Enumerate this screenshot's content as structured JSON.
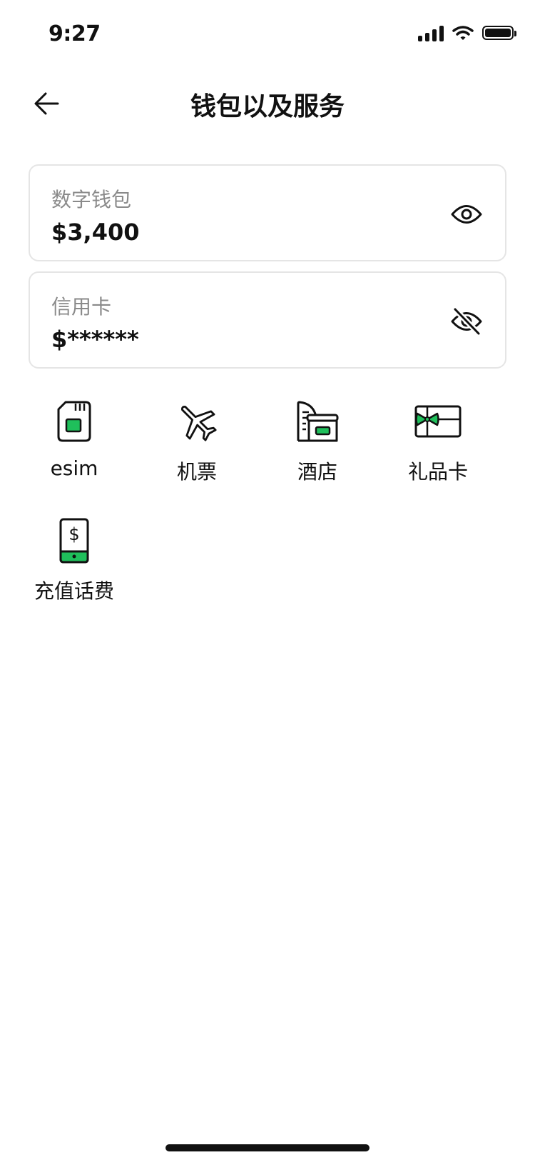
{
  "status": {
    "time": "9:27"
  },
  "header": {
    "title": "钱包以及服务"
  },
  "cards": [
    {
      "label": "数字钱包",
      "value": "$3,400",
      "eye": "eye-open-icon"
    },
    {
      "label": "信用卡",
      "value": "$******",
      "eye": "eye-closed-icon"
    }
  ],
  "services": [
    {
      "label": "esim",
      "icon": "sim-card-icon"
    },
    {
      "label": "机票",
      "icon": "airplane-icon"
    },
    {
      "label": "酒店",
      "icon": "hotel-icon"
    },
    {
      "label": "礼品卡",
      "icon": "gift-card-icon"
    },
    {
      "label": "充值话费",
      "icon": "phone-topup-icon"
    }
  ],
  "colors": {
    "accent": "#1FBF5B",
    "text": "#111111",
    "muted": "#8A8A8A",
    "border": "#E5E5E5"
  }
}
